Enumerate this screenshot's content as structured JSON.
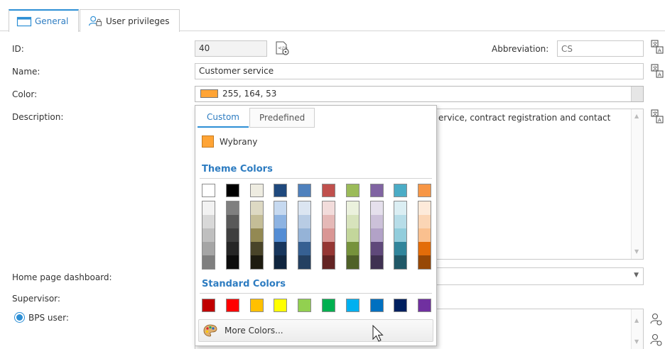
{
  "tabs": [
    {
      "label": "General",
      "active": true,
      "icon": "window-icon"
    },
    {
      "label": "User privileges",
      "active": false,
      "icon": "user-lock-icon"
    }
  ],
  "form": {
    "id": {
      "label": "ID:",
      "value": "40"
    },
    "abbreviation": {
      "label": "Abbreviation:",
      "placeholder": "CS"
    },
    "name": {
      "label": "Name:",
      "value": "Customer service"
    },
    "color": {
      "label": "Color:",
      "value": "255, 164, 53",
      "swatch": "#ffa435"
    },
    "description": {
      "label": "Description:",
      "visible_text": "ervice, contract registration and contact"
    },
    "home_page_dashboard": {
      "label": "Home page dashboard:"
    },
    "supervisor": {
      "label": "Supervisor:"
    },
    "bps_user": {
      "label": "BPS user:",
      "selected": true
    }
  },
  "color_picker": {
    "tabs": [
      "Custom",
      "Predefined"
    ],
    "selected": {
      "label": "Wybrany",
      "color": "#ffa435"
    },
    "theme_title": "Theme Colors",
    "theme_top_row": [
      "#ffffff",
      "#000000",
      "#eeece1",
      "#1f497d",
      "#4f81bd",
      "#c0504d",
      "#9bbb59",
      "#8064a2",
      "#4bacc6",
      "#f79646"
    ],
    "theme_columns": [
      [
        "#f2f2f2",
        "#d8d8d8",
        "#bfbfbf",
        "#a5a5a5",
        "#7f7f7f"
      ],
      [
        "#7f7f7f",
        "#595959",
        "#3f3f3f",
        "#262626",
        "#0c0c0c"
      ],
      [
        "#ddd9c3",
        "#c4bd97",
        "#938953",
        "#494429",
        "#1d1b10"
      ],
      [
        "#c6d9f0",
        "#8db3e2",
        "#548dd4",
        "#17365d",
        "#0f243e"
      ],
      [
        "#dbe5f1",
        "#b8cce4",
        "#95b3d7",
        "#366092",
        "#244061"
      ],
      [
        "#f2dcdb",
        "#e5b9b7",
        "#d99694",
        "#953734",
        "#632423"
      ],
      [
        "#ebf1dd",
        "#d7e3bc",
        "#c3d69b",
        "#76923c",
        "#4f6128"
      ],
      [
        "#e5e0ec",
        "#ccc1d9",
        "#b2a2c7",
        "#5f497a",
        "#3f3151"
      ],
      [
        "#dbeef3",
        "#b7dde8",
        "#92cddc",
        "#31859b",
        "#205867"
      ],
      [
        "#fdeada",
        "#fbd5b5",
        "#fac08f",
        "#e36c09",
        "#974806"
      ]
    ],
    "standard_title": "Standard Colors",
    "standard_colors": [
      "#c00000",
      "#ff0000",
      "#ffc000",
      "#ffff00",
      "#92d050",
      "#00b050",
      "#00b0f0",
      "#0070c0",
      "#002060",
      "#7030a0"
    ],
    "more_colors_label": "More Colors...",
    "more_colors_icon": "palette-icon"
  },
  "accent_color": "#2d8fd5"
}
